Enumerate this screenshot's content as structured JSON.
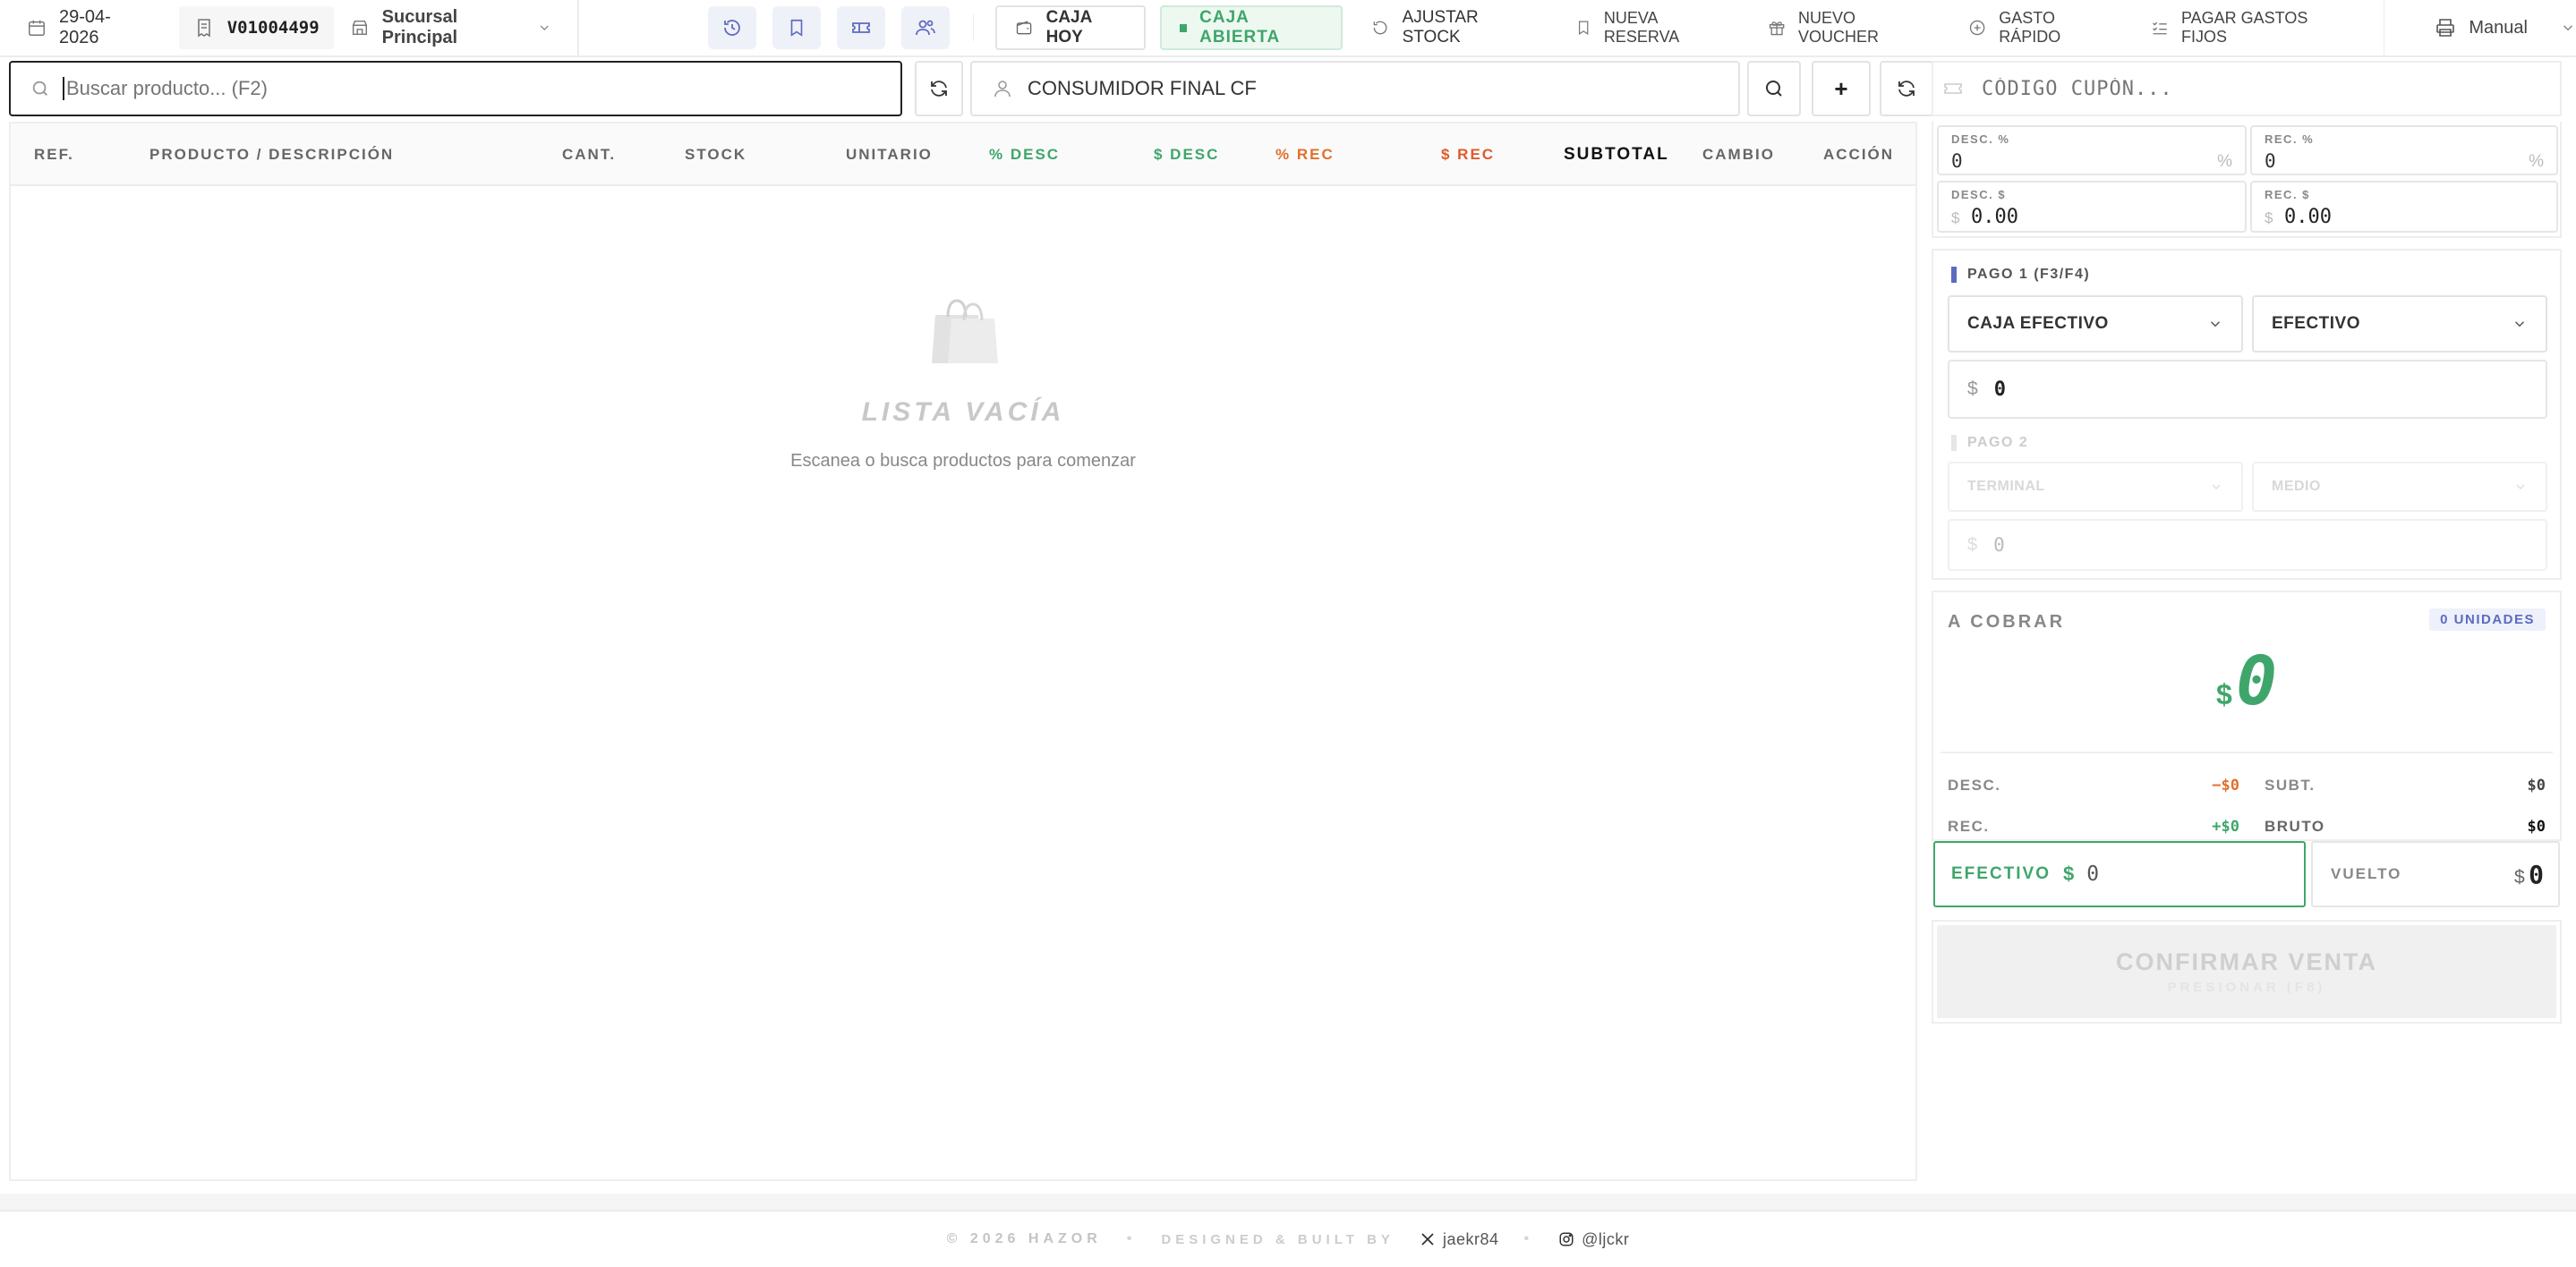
{
  "topbar": {
    "date": "29-04-2026",
    "ticket": "V01004499",
    "branch": "Sucursal Principal",
    "caja_hoy": "CAJA HOY",
    "caja_abierta": "CAJA ABIERTA",
    "ajustar_stock": "AJUSTAR STOCK",
    "nueva_reserva": "NUEVA RESERVA",
    "nuevo_voucher": "NUEVO VOUCHER",
    "gasto_rapido": "GASTO RÁPIDO",
    "pagar_gastos_fijos": "PAGAR GASTOS FIJOS",
    "print_mode": "Manual"
  },
  "search": {
    "placeholder": "Buscar producto... (F2)",
    "customer": "CONSUMIDOR FINAL CF",
    "add_label": "+"
  },
  "coupon": {
    "placeholder": "CÓDIGO CUPÓN..."
  },
  "table": {
    "columns": [
      "REF.",
      "PRODUCTO / DESCRIPCIÓN",
      "CANT.",
      "STOCK",
      "UNITARIO",
      "% DESC",
      "$ DESC",
      "% REC",
      "$ REC",
      "SUBTOTAL",
      "CAMBIO",
      "ACCIÓN"
    ],
    "empty_title": "LISTA VACÍA",
    "empty_subtitle": "Escanea o busca productos para comenzar"
  },
  "adjust": {
    "desc_pct_label": "DESC. %",
    "desc_pct_value": "0",
    "pct_symbol": "%",
    "rec_pct_label": "REC. %",
    "rec_pct_value": "0",
    "desc_amt_label": "DESC. $",
    "desc_amt_value": "0.00",
    "currency": "$",
    "rec_amt_label": "REC. $",
    "rec_amt_value": "0.00"
  },
  "pago1": {
    "title": "PAGO 1 (F3/F4)",
    "caja": "CAJA EFECTIVO",
    "medio": "EFECTIVO",
    "amount": "0"
  },
  "pago2": {
    "title": "PAGO 2",
    "terminal": "TERMINAL",
    "medio": "MEDIO",
    "amount": "0"
  },
  "summary": {
    "a_cobrar": "A COBRAR",
    "unidades": "0 UNIDADES",
    "total": "0",
    "desc_label": "DESC.",
    "desc_value": "−$0",
    "subt_label": "SUBT.",
    "subt_value": "$0",
    "rec_label": "REC.",
    "rec_value": "+$0",
    "bruto_label": "BRUTO",
    "bruto_value": "$0"
  },
  "cash": {
    "efectivo_label": "EFECTIVO",
    "efectivo_value": "0",
    "vuelto_label": "VUELTO",
    "vuelto_value": "0"
  },
  "confirm": {
    "label": "CONFIRMAR VENTA",
    "hint": "PRESIONAR (F8)"
  },
  "footer": {
    "copyright": "© 2026 HAZOR",
    "dot": "•",
    "designed": "DESIGNED & BUILT BY",
    "x_handle": "jaekr84",
    "ig_handle": "@ljckr"
  },
  "colors": {
    "green": "#3fa66b",
    "orange": "#e0702d",
    "indigo": "#5c6bc0",
    "red_orange": "#e05a2b"
  }
}
